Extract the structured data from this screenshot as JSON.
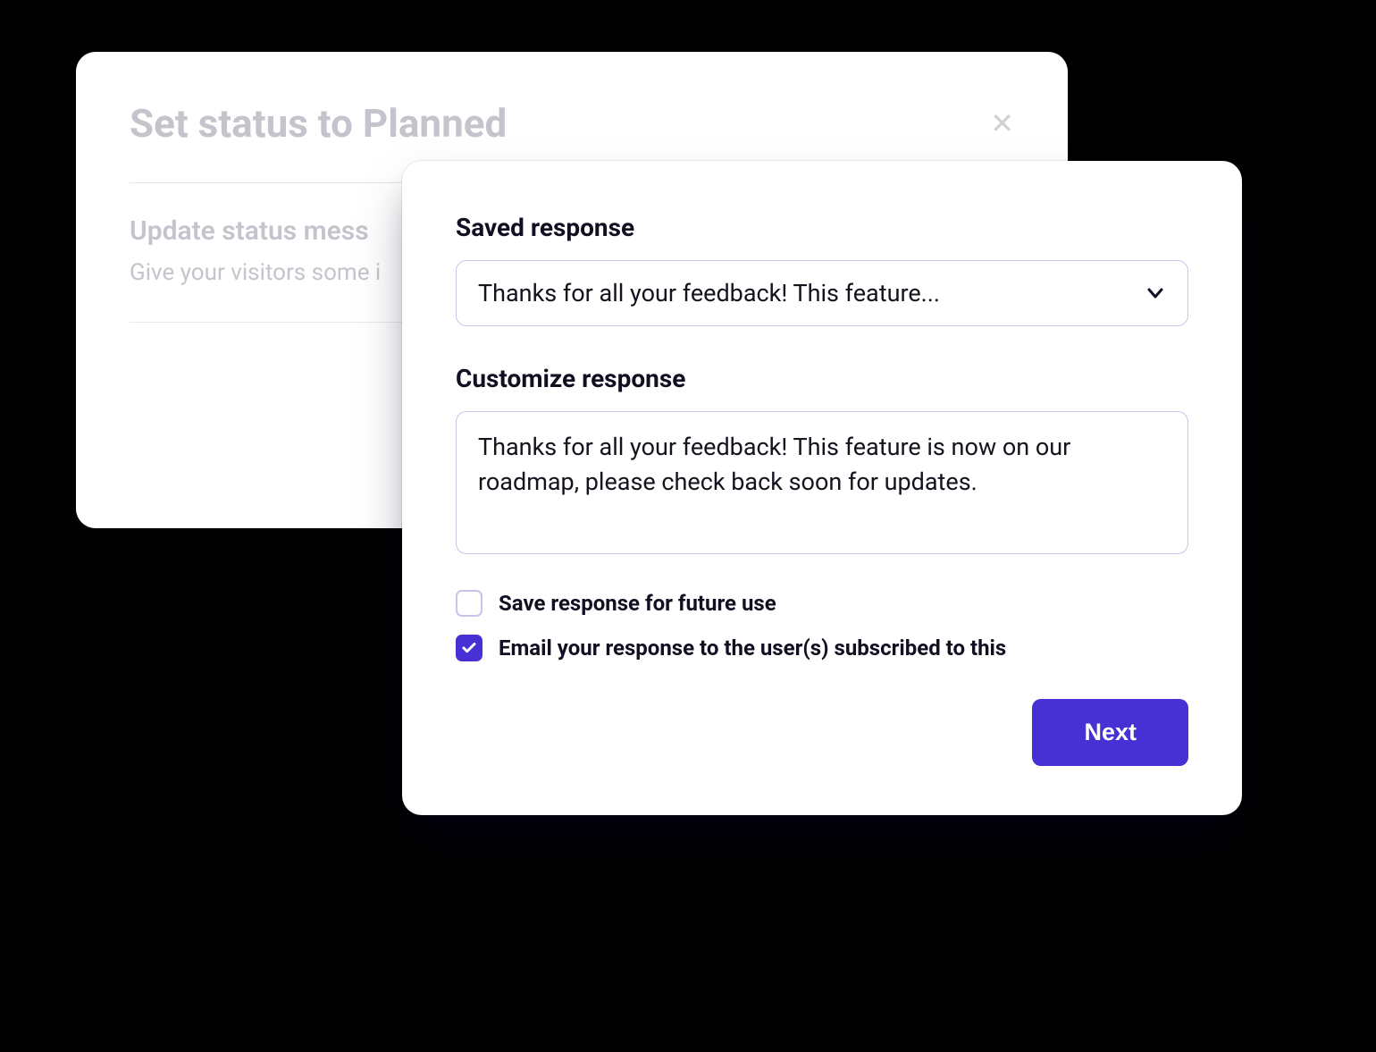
{
  "back_card": {
    "title": "Set status to Planned",
    "sub_heading": "Update status mess",
    "sub_text": "Give your visitors some i"
  },
  "front_card": {
    "saved_response_label": "Saved response",
    "saved_response_value": "Thanks for all your feedback! This feature...",
    "customize_label": "Customize response",
    "customize_text": "Thanks for all your feedback! This feature is now on our roadmap, please check back soon for updates.",
    "save_for_future_label": "Save response for future use",
    "email_users_label": "Email your response to the user(s) subscribed to this",
    "next_button": "Next"
  }
}
